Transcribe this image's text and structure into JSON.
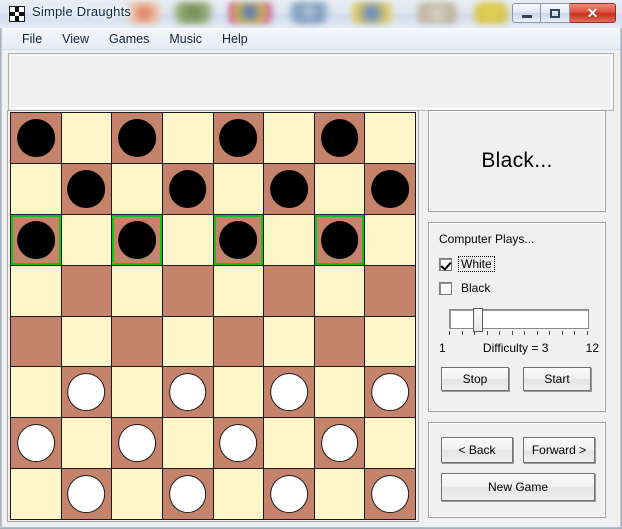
{
  "window": {
    "title": "Simple Draughts",
    "icon": "checkerboard-icon",
    "minimize_label": "",
    "maximize_label": "",
    "close_label": "✕"
  },
  "menu": {
    "items": [
      {
        "label": "File"
      },
      {
        "label": "View"
      },
      {
        "label": "Games"
      },
      {
        "label": "Music"
      },
      {
        "label": "Help"
      }
    ]
  },
  "status": {
    "text": "Black..."
  },
  "computer_plays": {
    "title": "Computer Plays...",
    "options": [
      {
        "label": "White",
        "checked": true,
        "focused": true
      },
      {
        "label": "Black",
        "checked": false,
        "focused": false
      }
    ]
  },
  "difficulty": {
    "min_label": "1",
    "max_label": "12",
    "value_label": "Difficulty = 3",
    "value": 3,
    "min": 1,
    "max": 12,
    "tick_count": 12
  },
  "controls": {
    "stop_label": "Stop",
    "start_label": "Start",
    "back_label": "< Back",
    "forward_label": "Forward >",
    "new_game_label": "New Game"
  },
  "colors": {
    "light_square": "#fcf6c8",
    "dark_square": "#c4836a",
    "black_piece": "#000000",
    "white_piece": "#ffffff",
    "highlight": "#16c116",
    "close_button": "#c62f1c"
  },
  "board": {
    "rows": 8,
    "cols": 8,
    "cells": [
      [
        {
          "shade": "dark",
          "piece": "black",
          "highlight": false
        },
        {
          "shade": "light",
          "piece": null,
          "highlight": false
        },
        {
          "shade": "dark",
          "piece": "black",
          "highlight": false
        },
        {
          "shade": "light",
          "piece": null,
          "highlight": false
        },
        {
          "shade": "dark",
          "piece": "black",
          "highlight": false
        },
        {
          "shade": "light",
          "piece": null,
          "highlight": false
        },
        {
          "shade": "dark",
          "piece": "black",
          "highlight": false
        },
        {
          "shade": "light",
          "piece": null,
          "highlight": false
        }
      ],
      [
        {
          "shade": "light",
          "piece": null,
          "highlight": false
        },
        {
          "shade": "dark",
          "piece": "black",
          "highlight": false
        },
        {
          "shade": "light",
          "piece": null,
          "highlight": false
        },
        {
          "shade": "dark",
          "piece": "black",
          "highlight": false
        },
        {
          "shade": "light",
          "piece": null,
          "highlight": false
        },
        {
          "shade": "dark",
          "piece": "black",
          "highlight": false
        },
        {
          "shade": "light",
          "piece": null,
          "highlight": false
        },
        {
          "shade": "dark",
          "piece": "black",
          "highlight": false
        }
      ],
      [
        {
          "shade": "dark",
          "piece": "black",
          "highlight": true
        },
        {
          "shade": "light",
          "piece": null,
          "highlight": false
        },
        {
          "shade": "dark",
          "piece": "black",
          "highlight": true
        },
        {
          "shade": "light",
          "piece": null,
          "highlight": false
        },
        {
          "shade": "dark",
          "piece": "black",
          "highlight": true
        },
        {
          "shade": "light",
          "piece": null,
          "highlight": false
        },
        {
          "shade": "dark",
          "piece": "black",
          "highlight": true
        },
        {
          "shade": "light",
          "piece": null,
          "highlight": false
        }
      ],
      [
        {
          "shade": "light",
          "piece": null,
          "highlight": false
        },
        {
          "shade": "dark",
          "piece": null,
          "highlight": false
        },
        {
          "shade": "light",
          "piece": null,
          "highlight": false
        },
        {
          "shade": "dark",
          "piece": null,
          "highlight": false
        },
        {
          "shade": "light",
          "piece": null,
          "highlight": false
        },
        {
          "shade": "dark",
          "piece": null,
          "highlight": false
        },
        {
          "shade": "light",
          "piece": null,
          "highlight": false
        },
        {
          "shade": "dark",
          "piece": null,
          "highlight": false
        }
      ],
      [
        {
          "shade": "dark",
          "piece": null,
          "highlight": false
        },
        {
          "shade": "light",
          "piece": null,
          "highlight": false
        },
        {
          "shade": "dark",
          "piece": null,
          "highlight": false
        },
        {
          "shade": "light",
          "piece": null,
          "highlight": false
        },
        {
          "shade": "dark",
          "piece": null,
          "highlight": false
        },
        {
          "shade": "light",
          "piece": null,
          "highlight": false
        },
        {
          "shade": "dark",
          "piece": null,
          "highlight": false
        },
        {
          "shade": "light",
          "piece": null,
          "highlight": false
        }
      ],
      [
        {
          "shade": "light",
          "piece": null,
          "highlight": false
        },
        {
          "shade": "dark",
          "piece": "white",
          "highlight": false
        },
        {
          "shade": "light",
          "piece": null,
          "highlight": false
        },
        {
          "shade": "dark",
          "piece": "white",
          "highlight": false
        },
        {
          "shade": "light",
          "piece": null,
          "highlight": false
        },
        {
          "shade": "dark",
          "piece": "white",
          "highlight": false
        },
        {
          "shade": "light",
          "piece": null,
          "highlight": false
        },
        {
          "shade": "dark",
          "piece": "white",
          "highlight": false
        }
      ],
      [
        {
          "shade": "dark",
          "piece": "white",
          "highlight": false
        },
        {
          "shade": "light",
          "piece": null,
          "highlight": false
        },
        {
          "shade": "dark",
          "piece": "white",
          "highlight": false
        },
        {
          "shade": "light",
          "piece": null,
          "highlight": false
        },
        {
          "shade": "dark",
          "piece": "white",
          "highlight": false
        },
        {
          "shade": "light",
          "piece": null,
          "highlight": false
        },
        {
          "shade": "dark",
          "piece": "white",
          "highlight": false
        },
        {
          "shade": "light",
          "piece": null,
          "highlight": false
        }
      ],
      [
        {
          "shade": "light",
          "piece": null,
          "highlight": false
        },
        {
          "shade": "dark",
          "piece": "white",
          "highlight": false
        },
        {
          "shade": "light",
          "piece": null,
          "highlight": false
        },
        {
          "shade": "dark",
          "piece": "white",
          "highlight": false
        },
        {
          "shade": "light",
          "piece": null,
          "highlight": false
        },
        {
          "shade": "dark",
          "piece": "white",
          "highlight": false
        },
        {
          "shade": "light",
          "piece": null,
          "highlight": false
        },
        {
          "shade": "dark",
          "piece": "white",
          "highlight": false
        }
      ]
    ]
  }
}
